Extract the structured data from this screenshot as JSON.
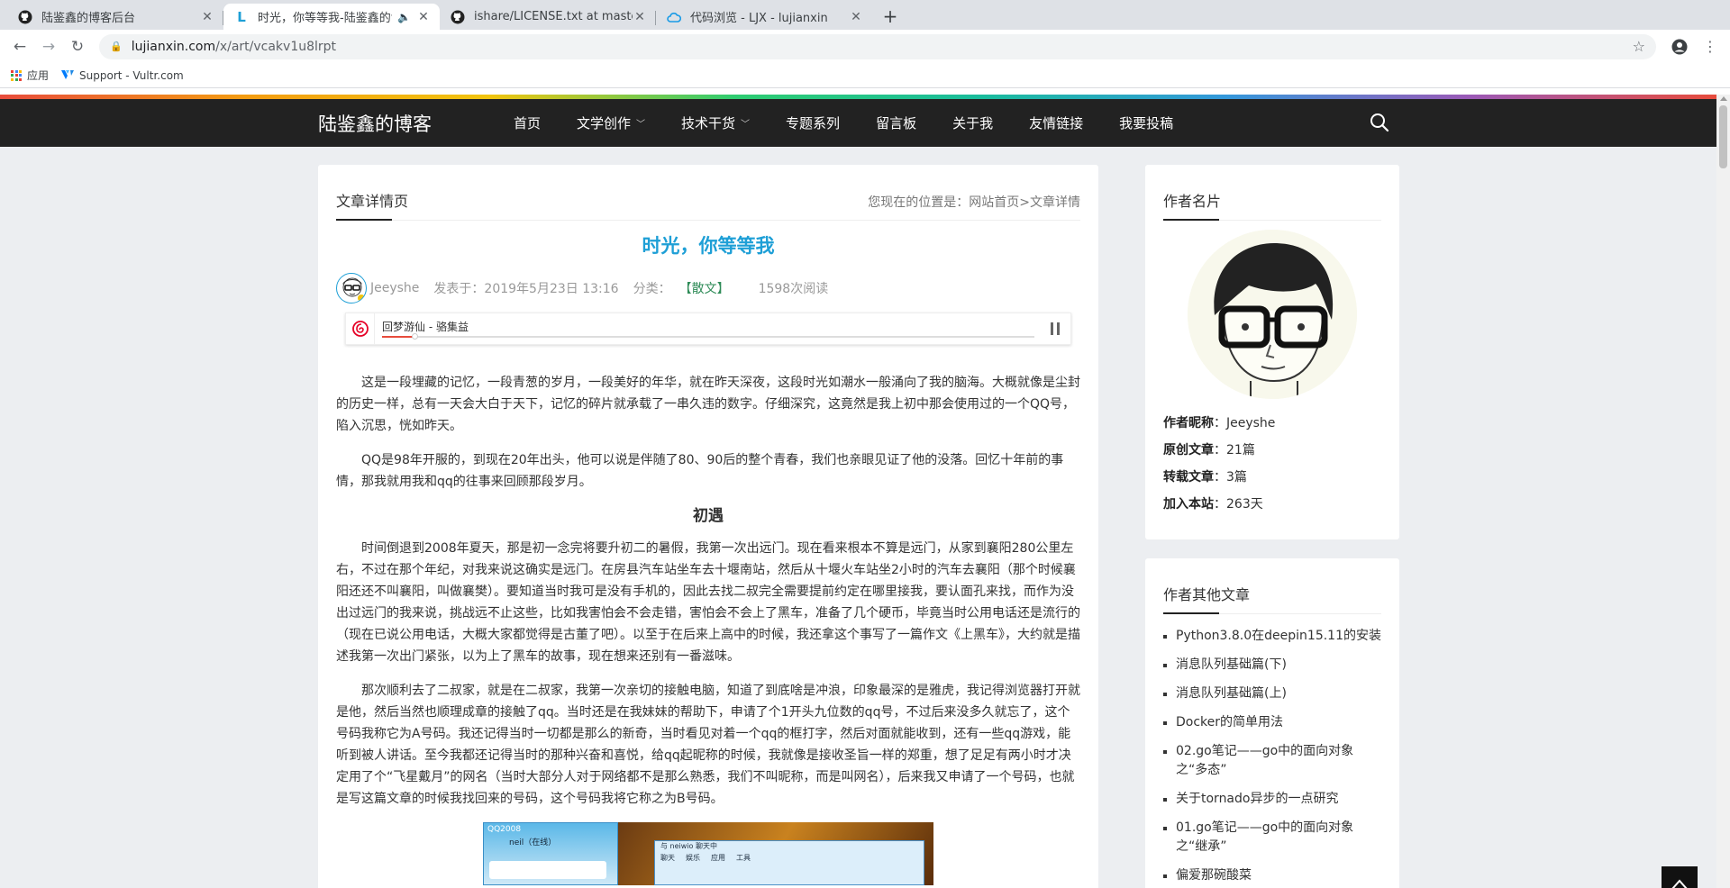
{
  "browser": {
    "tabs": [
      {
        "title": "陆鉴鑫的博客后台",
        "icon": "github-icon",
        "active": false
      },
      {
        "title": "时光，你等等我-陆鉴鑫的博客",
        "icon": "site-l-icon",
        "active": true,
        "audio": true
      },
      {
        "title": "ishare/LICENSE.txt at master · ",
        "icon": "github-icon",
        "active": false
      },
      {
        "title": "代码浏览 - LJX - lujianxin",
        "icon": "cloud-icon",
        "active": false
      }
    ],
    "url_host": "lujianxin.com",
    "url_path": "/x/art/vcakv1u8lrpt",
    "bookmarks": [
      {
        "label": "应用",
        "icon": "apps-grid-icon"
      },
      {
        "label": "Support - Vultr.com",
        "icon": "vultr-icon"
      }
    ]
  },
  "site": {
    "logo": "陆鉴鑫的博客",
    "menu": [
      {
        "label": "首页",
        "dropdown": false
      },
      {
        "label": "文学创作",
        "dropdown": true
      },
      {
        "label": "技术干货",
        "dropdown": true
      },
      {
        "label": "专题系列",
        "dropdown": false
      },
      {
        "label": "留言板",
        "dropdown": false
      },
      {
        "label": "关于我",
        "dropdown": false
      },
      {
        "label": "友情链接",
        "dropdown": false
      },
      {
        "label": "我要投稿",
        "dropdown": false
      }
    ]
  },
  "article": {
    "section_label": "文章详情页",
    "location": "您现在的位置是：网站首页>文章详情",
    "title": "时光，你等等我",
    "author": "Jeeyshe",
    "published": "发表于：2019年5月23日 13:16",
    "category_prefix": "分类：",
    "category": "【散文】",
    "reads": "1598次阅读",
    "player_track": "回梦游仙 - 骆集益",
    "player_progress": 0.05,
    "paragraphs": [
      "这是一段埋藏的记忆，一段青葱的岁月，一段美好的年华，就在昨天深夜，这段时光如潮水一般涌向了我的脑海。大概就像是尘封的历史一样，总有一天会大白于天下，记忆的碎片就承载了一串久违的数字。仔细深究，这竟然是我上初中那会使用过的一个QQ号，陷入沉思，恍如昨天。",
      "QQ是98年开服的，到现在20年出头，他可以说是伴随了80、90后的整个青春，我们也亲眼见证了他的没落。回忆十年前的事情，那我就用我和qq的往事来回顾那段岁月。"
    ],
    "heading": "初遇",
    "paragraphs2": [
      "时间倒退到2008年夏天，那是初一念完将要升初二的暑假，我第一次出远门。现在看来根本不算是远门，从家到襄阳280公里左右，不过在那个年纪，对我来说这确实是远门。在房县汽车站坐车去十堰南站，然后从十堰火车站坐2小时的汽车去襄阳（那个时候襄阳还还不叫襄阳，叫做襄樊）。要知道当时我可是没有手机的，因此去找二叔完全需要提前约定在哪里接我，要认面孔来找，而作为没出过远门的我来说，挑战远不止这些，比如我害怕会不会走错，害怕会不会上了黑车，准备了几个硬币，毕竟当时公用电话还是流行的（现在已说公用电话，大概大家都觉得是古董了吧）。以至于在后来上高中的时候，我还拿这个事写了一篇作文《上黑车》，大约就是描述我第一次出门紧张，以为上了黑车的故事，现在想来还别有一番滋味。",
      "那次顺利去了二叔家，就是在二叔家，我第一次亲切的接触电脑，知道了到底啥是冲浪，印象最深的是雅虎，我记得浏览器打开就是他，然后当然也顺理成章的接触了qq。当时还是在我妹妹的帮助下，申请了个1开头九位数的qq号，不过后来没多久就忘了，这个号码我称它为A号码。我还记得当时一切都是那么的新奇，当时看见对着一个qq的框打字，然后对面就能收到，还有一些qq游戏，能听到被人讲话。至今我都还记得当时的那种兴奋和喜悦，给qq起昵称的时候，我就像是接收圣旨一样的郑重，想了足足有两小时才决定用了个“飞星戴月”的网名（当时大部分人对于网络都不是那么熟悉，我们不叫昵称，而是叫网名），后来我又申请了一个号码，也就是写这篇文章的时候我找回来的号码，这个号码我将它称之为B号码。"
    ],
    "screenshot_labels": {
      "qq_num": "QQ2008",
      "user": "neil（在线）",
      "chat": "与 neiwio 聊天中",
      "tabs": [
        "聊天",
        "娱乐",
        "应用",
        "工具"
      ]
    }
  },
  "author_card": {
    "heading": "作者名片",
    "rows": [
      {
        "label": "作者昵称",
        "value": "Jeeyshe"
      },
      {
        "label": "原创文章",
        "value": "21篇"
      },
      {
        "label": "转载文章",
        "value": "3篇"
      },
      {
        "label": "加入本站",
        "value": "263天"
      }
    ]
  },
  "other_posts": {
    "heading": "作者其他文章",
    "items": [
      "Python3.8.0在deepin15.11的安装",
      "消息队列基础篇(下)",
      "消息队列基础篇(上)",
      "Docker的简单用法",
      "02.go笔记——go中的面向对象之“多态”",
      "关于tornado异步的一点研究",
      "01.go笔记——go中的面向对象之“继承”",
      "偏爱那碗酸菜"
    ]
  },
  "colors": {
    "title_blue": "#1e9fd6",
    "nav_bg": "#222222",
    "category_green": "#2e8b57"
  }
}
